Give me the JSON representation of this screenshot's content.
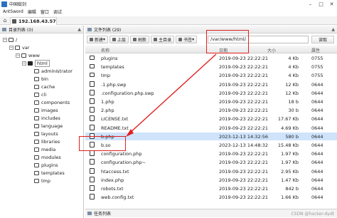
{
  "window": {
    "title": "中国蚁剑"
  },
  "menu": [
    "AntSword",
    "编辑",
    "窗口",
    "调试"
  ],
  "tabs": {
    "host": "192.168.43.57"
  },
  "left_panel": {
    "title": "目录列表 (0)"
  },
  "tree": [
    {
      "label": "/",
      "depth": 0,
      "expanded": true
    },
    {
      "label": "var",
      "depth": 1,
      "expanded": true
    },
    {
      "label": "www",
      "depth": 2,
      "expanded": true
    },
    {
      "label": "html",
      "depth": 3,
      "expanded": true,
      "selected": true
    },
    {
      "label": "administrator",
      "depth": 4
    },
    {
      "label": "bin",
      "depth": 4
    },
    {
      "label": "cache",
      "depth": 4
    },
    {
      "label": "cli",
      "depth": 4
    },
    {
      "label": "components",
      "depth": 4
    },
    {
      "label": "images",
      "depth": 4
    },
    {
      "label": "includes",
      "depth": 4
    },
    {
      "label": "language",
      "depth": 4
    },
    {
      "label": "layouts",
      "depth": 4
    },
    {
      "label": "libraries",
      "depth": 4
    },
    {
      "label": "media",
      "depth": 4
    },
    {
      "label": "modules",
      "depth": 4
    },
    {
      "label": "plugins",
      "depth": 4
    },
    {
      "label": "templates",
      "depth": 4
    },
    {
      "label": "tmp",
      "depth": 4
    }
  ],
  "right_panel": {
    "title": "文件列表 (29)"
  },
  "toolbar": {
    "new": "新建",
    "up": "上层",
    "refresh": "刷新",
    "home": "主目录",
    "bookmark": "书签",
    "path": "/var/www/html/",
    "go": "读取"
  },
  "columns": {
    "name": "名称",
    "date": "日期",
    "size": "大小",
    "perm": "属性"
  },
  "files": [
    {
      "name": "plugins",
      "type": "folder",
      "date": "2019-09-23 22:22:21",
      "size": "4 Kb",
      "perm": "0755"
    },
    {
      "name": "templates",
      "type": "folder",
      "date": "2019-09-23 22:22:21",
      "size": "4 Kb",
      "perm": "0755"
    },
    {
      "name": "tmp",
      "type": "folder",
      "date": "2019-09-23 22:22:21",
      "size": "4 Kb",
      "perm": "0755"
    },
    {
      "name": ".1.php.swp",
      "type": "file",
      "date": "2019-09-23 22:22:21",
      "size": "12 Kb",
      "perm": "0644"
    },
    {
      "name": ".configuration.php.swp",
      "type": "file",
      "date": "2019-09-23 22:22:21",
      "size": "12 Kb",
      "perm": "0644"
    },
    {
      "name": "1.php",
      "type": "file",
      "date": "2019-09-23 22:22:21",
      "size": "18 b",
      "perm": "0644"
    },
    {
      "name": "2.php",
      "type": "file",
      "date": "2019-09-23 22:22:21",
      "size": "30 b",
      "perm": "0644"
    },
    {
      "name": "LICENSE.txt",
      "type": "file",
      "date": "2019-09-23 22:22:21",
      "size": "17.67 Kb",
      "perm": "0644"
    },
    {
      "name": "README.txt",
      "type": "file",
      "date": "2019-09-23 22:22:21",
      "size": "4.69 Kb",
      "perm": "0644"
    },
    {
      "name": "b.php",
      "type": "file",
      "date": "2023-12-13 14:32:56",
      "size": "580 b",
      "perm": "0644",
      "selected": true
    },
    {
      "name": "b.so",
      "type": "file",
      "date": "2023-12-13 14:48:32",
      "size": "15.48 Kb",
      "perm": "0644"
    },
    {
      "name": "configuration.php",
      "type": "file",
      "date": "2019-09-23 22:22:21",
      "size": "1.97 Kb",
      "perm": "0644"
    },
    {
      "name": "configuration.php~",
      "type": "file",
      "date": "2019-09-23 22:22:21",
      "size": "1.97 Kb",
      "perm": "0644"
    },
    {
      "name": "htaccess.txt",
      "type": "file",
      "date": "2019-09-23 22:22:21",
      "size": "2.95 Kb",
      "perm": "0644"
    },
    {
      "name": "index.php",
      "type": "file",
      "date": "2019-09-23 22:22:21",
      "size": "1.47 Kb",
      "perm": "0644"
    },
    {
      "name": "robots.txt",
      "type": "file",
      "date": "2019-09-23 22:22:21",
      "size": "842 b",
      "perm": "0644"
    },
    {
      "name": "web.config.txt",
      "type": "file",
      "date": "2019-09-23 22:22:21",
      "size": "1.66 Kb",
      "perm": "0644"
    }
  ],
  "status": {
    "label": "任务列表"
  },
  "watermark": "CSDN @hacker-dydt",
  "colors": {
    "annotation": "#e02020",
    "selection": "#cfe3fb"
  }
}
